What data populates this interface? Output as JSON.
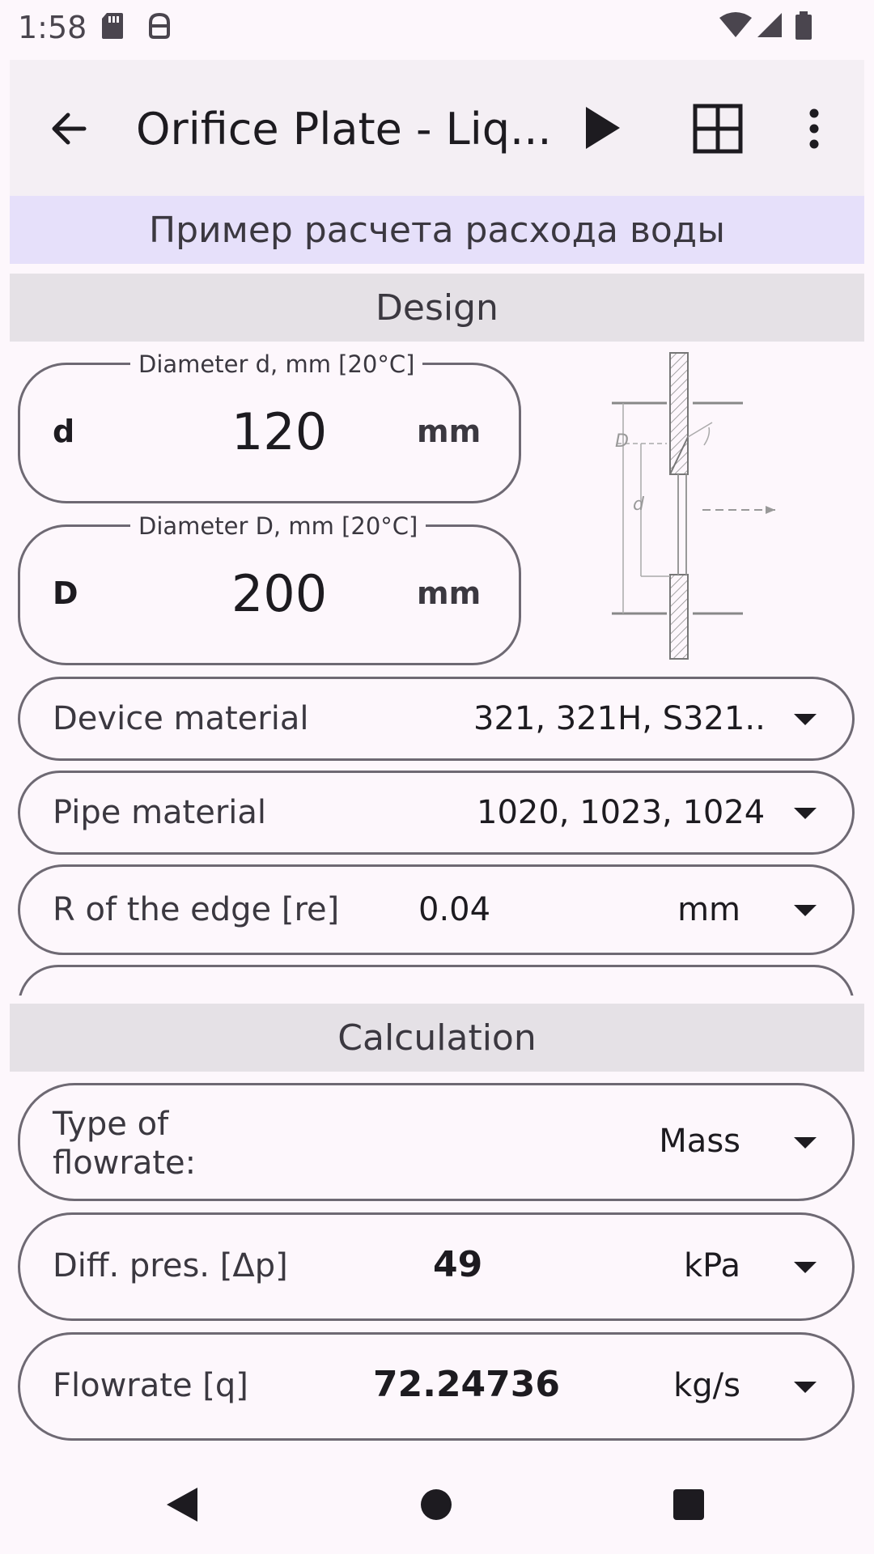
{
  "status_bar": {
    "time": "1:58",
    "icons": [
      "sd-card-icon",
      "android-debug-icon",
      "wifi-icon",
      "signal-icon",
      "battery-icon"
    ]
  },
  "app_bar": {
    "title": "Orifice Plate - Liq...",
    "icons": [
      "back-arrow-icon",
      "play-icon",
      "grid-icon",
      "more-vert-icon"
    ]
  },
  "banner": "Пример расчета расхода воды",
  "design": {
    "header": "Design",
    "diameter_d": {
      "legend": "Diameter d, mm [20°C]",
      "symbol": "d",
      "value": "120",
      "unit": "mm"
    },
    "diameter_D": {
      "legend": "Diameter D, mm [20°C]",
      "symbol": "D",
      "value": "200",
      "unit": "mm"
    },
    "diagram_labels": {
      "D": "D",
      "d": "d"
    },
    "device_material": {
      "label": "Device material",
      "value": "321, 321H, S321.."
    },
    "pipe_material": {
      "label": "Pipe material",
      "value": "1020, 1023, 1024"
    },
    "edge_radius": {
      "label": "R of the edge [re]",
      "value": "0.04",
      "unit": "mm"
    }
  },
  "calculation": {
    "header": "Calculation",
    "flow_type": {
      "label_line1": "Type of",
      "label_line2": "flowrate:",
      "value": "Mass"
    },
    "diff_pressure": {
      "label": "Diff. pres. [Δp]",
      "value": "49",
      "unit": "kPa"
    },
    "flowrate": {
      "label": "Flowrate [q]",
      "value": "72.24736",
      "unit": "kg/s"
    }
  },
  "nav_bar": {
    "icons": [
      "nav-back-icon",
      "nav-home-icon",
      "nav-recents-icon"
    ]
  }
}
